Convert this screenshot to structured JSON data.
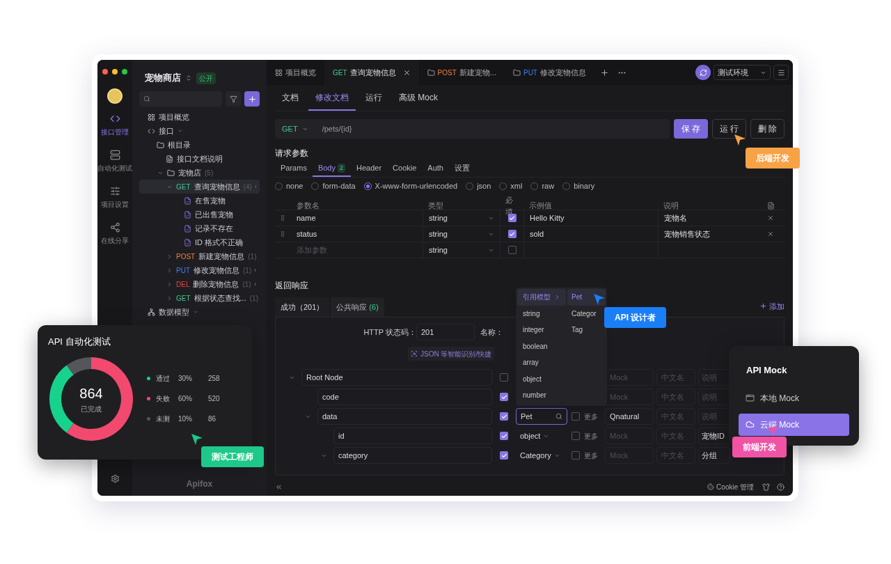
{
  "rail": {
    "items": [
      {
        "kind": "api",
        "label": "接口管理",
        "selected": true
      },
      {
        "kind": "test",
        "label": "自动化测试",
        "selected": false
      },
      {
        "kind": "settings",
        "label": "项目设置",
        "selected": false
      },
      {
        "kind": "share",
        "label": "在线分享",
        "selected": false
      }
    ]
  },
  "sidebar": {
    "project": "宠物商店",
    "badge": "公开",
    "footer_logo": "Apifox",
    "tree": [
      {
        "kind": "overview",
        "label": "项目概览"
      },
      {
        "kind": "group",
        "label": "接口",
        "children": [
          {
            "kind": "folder",
            "label": "根目录",
            "children": [
              {
                "kind": "doc",
                "label": "接口文档说明"
              },
              {
                "kind": "folder",
                "label": "宠物店",
                "count": "(5)",
                "expanded": true,
                "children": [
                  {
                    "kind": "api",
                    "method": "GET",
                    "color": "#3ecf8e",
                    "label": "查询宠物信息",
                    "count": "(4)",
                    "expanded": true,
                    "selected": true,
                    "children": [
                      {
                        "kind": "case",
                        "label": "在售宠物",
                        "selected": false
                      },
                      {
                        "kind": "case",
                        "label": "已出售宠物",
                        "selected": false
                      },
                      {
                        "kind": "case",
                        "label": "记录不存在",
                        "selected": false
                      },
                      {
                        "kind": "case",
                        "label": "ID 格式不正确",
                        "selected": false
                      }
                    ]
                  },
                  {
                    "kind": "api",
                    "method": "POST",
                    "color": "#f5823a",
                    "label": "新建宠物信息",
                    "count": "(1)",
                    "expanded": false,
                    "selected": false
                  },
                  {
                    "kind": "api",
                    "method": "PUT",
                    "color": "#3b82f6",
                    "label": "修改宠物信息",
                    "count": "(1)",
                    "expanded": false,
                    "selected": false
                  },
                  {
                    "kind": "api",
                    "method": "DEL",
                    "color": "#ef4444",
                    "label": "删除宠物信息",
                    "count": "(1)",
                    "expanded": false,
                    "selected": false
                  },
                  {
                    "kind": "api",
                    "method": "GET",
                    "color": "#3ecf8e",
                    "label": "根据状态查找...",
                    "count": "(1)",
                    "expanded": false,
                    "selected": false
                  }
                ]
              }
            ]
          }
        ]
      },
      {
        "kind": "group",
        "label": "数据模型"
      }
    ]
  },
  "tabs": [
    {
      "kind": "overview",
      "label": "项目概览",
      "selected": false
    },
    {
      "kind": "api",
      "method": "GET",
      "color": "#3ecf8e",
      "label": "查询宠物信息",
      "selected": true
    },
    {
      "kind": "folder",
      "method": "POST",
      "color": "#f5823a",
      "label": "新建宠物...",
      "selected": false
    },
    {
      "kind": "folder",
      "method": "PUT",
      "color": "#3b82f6",
      "label": "修改宠物信息",
      "selected": false
    }
  ],
  "env": "测试环境",
  "doc_tabs": [
    {
      "label": "文档",
      "selected": false
    },
    {
      "label": "修改文档",
      "selected": true
    },
    {
      "label": "运行",
      "selected": false
    },
    {
      "label": "高级 Mock",
      "selected": false
    }
  ],
  "request": {
    "method": "GET",
    "path": "/pets/{id}",
    "buttons": [
      {
        "label": "保 存",
        "kind": "primary"
      },
      {
        "label": "运 行",
        "kind": "default"
      },
      {
        "label": "删 除",
        "kind": "default"
      }
    ]
  },
  "params": {
    "title": "请求参数",
    "tabs": [
      {
        "label": "Params",
        "selected": false
      },
      {
        "label": "Body",
        "badge": "2",
        "selected": true
      },
      {
        "label": "Header",
        "selected": false
      },
      {
        "label": "Cookie",
        "selected": false
      },
      {
        "label": "Auth",
        "selected": false
      },
      {
        "label": "设置",
        "selected": false
      }
    ],
    "body_types": [
      {
        "label": "none",
        "selected": false
      },
      {
        "label": "form-data",
        "selected": false
      },
      {
        "label": "X-www-form-urlencoded",
        "selected": true
      },
      {
        "label": "json",
        "selected": false
      },
      {
        "label": "xml",
        "selected": false
      },
      {
        "label": "raw",
        "selected": false
      },
      {
        "label": "binary",
        "selected": false
      }
    ],
    "columns": [
      "参数名",
      "类型",
      "必填",
      "示例值",
      "说明"
    ],
    "rows": [
      {
        "name": "name",
        "type": "string",
        "required": true,
        "example": "Hello Kitty",
        "description": "宠物名"
      },
      {
        "name": "status",
        "type": "string",
        "required": true,
        "example": "sold",
        "description": "宠物销售状态"
      },
      {
        "name_placeholder": "添加参数",
        "type": "string",
        "required": false
      }
    ]
  },
  "response": {
    "title": "返回响应",
    "tabs": [
      {
        "label": "成功（201）",
        "selected": true
      },
      {
        "label": "公共响应",
        "count": "(6)",
        "selected": false
      }
    ],
    "add": "添加",
    "status_label": "HTTP 状态码：",
    "status": "201",
    "name_label": "名称：",
    "smart_link": "JSON 等智能识别/快捷",
    "tree": [
      {
        "name": "Root Node",
        "required": false,
        "expanded": true,
        "mock_placeholder": "Mock",
        "cn_placeholder": "中文名",
        "desc_placeholder": "说明",
        "children": [
          {
            "name": "code",
            "required": true,
            "mock_placeholder": "Mock",
            "cn_placeholder": "中文名",
            "desc_placeholder": "说明"
          },
          {
            "name": "data",
            "required": true,
            "expanded": true,
            "type": {
              "kind": "search",
              "value": "Pet"
            },
            "more": {
              "label": "更多",
              "checked": false
            },
            "mock": "Qnatural",
            "cn_placeholder": "中文名",
            "desc_placeholder": "说明",
            "children": [
              {
                "name": "id",
                "required": true,
                "type": {
                  "kind": "select",
                  "value": "object"
                },
                "more": {
                  "label": "更多",
                  "checked": false
                },
                "mock_placeholder": "Mock",
                "cn_placeholder": "中文名",
                "desc": "宠物ID"
              },
              {
                "name": "category",
                "required": true,
                "expanded": true,
                "type": {
                  "kind": "select",
                  "value": "Category"
                },
                "more": {
                  "label": "更多",
                  "checked": false
                },
                "mock_placeholder": "Mock",
                "cn_placeholder": "中文名",
                "desc": "分组"
              }
            ]
          }
        ]
      }
    ]
  },
  "type_menu": {
    "items": [
      {
        "kind": "submenu",
        "label": "引用模型",
        "selected": true
      },
      {
        "kind": "item",
        "label": "string",
        "selected": false
      },
      {
        "kind": "item",
        "label": "integer",
        "selected": false
      },
      {
        "kind": "item",
        "label": "boolean",
        "selected": false
      },
      {
        "kind": "item",
        "label": "array",
        "selected": false
      },
      {
        "kind": "item",
        "label": "object",
        "selected": false
      },
      {
        "kind": "item",
        "label": "number",
        "selected": false
      }
    ],
    "models": [
      {
        "label": "Pet",
        "selected": true
      },
      {
        "label": "Categor",
        "selected": false
      },
      {
        "label": "Tag",
        "selected": false
      }
    ]
  },
  "bottom_bar": {
    "cookie": "Cookie 管理"
  },
  "automation_card": {
    "title": "API 自动化测试",
    "total": "864",
    "total_label": "已完成",
    "legend": [
      {
        "percent": "30%",
        "count": "258",
        "color": "#17d28c"
      },
      {
        "percent": "60%",
        "count": "520",
        "color": "#f2496f"
      },
      {
        "percent": "10%",
        "count": "86",
        "color": "#55555c"
      }
    ],
    "chart_data": {
      "type": "donut",
      "categories": [
        "通过",
        "失败",
        "未测"
      ],
      "values": [
        30,
        60,
        10
      ]
    }
  },
  "mock_card": {
    "title": "API Mock",
    "items": [
      {
        "kind": "local",
        "label": "本地 Mock",
        "selected": false
      },
      {
        "kind": "cloud",
        "label": "云端 Mock",
        "selected": true
      }
    ]
  },
  "callouts": [
    {
      "label": "后端开发",
      "color": "#f8a246"
    },
    {
      "label": "API 设计者",
      "color": "#1a7ef7"
    },
    {
      "label": "测试工程师",
      "color": "#1dc888"
    },
    {
      "label": "前端开发",
      "color": "#f052a6"
    }
  ]
}
